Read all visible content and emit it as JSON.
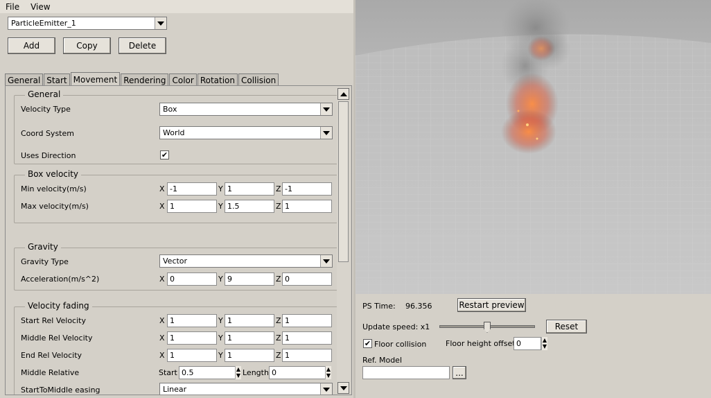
{
  "menu": {
    "file": "File",
    "view": "View"
  },
  "emitter_select": {
    "value": "ParticleEmitter_1"
  },
  "actions": {
    "add": "Add",
    "copy": "Copy",
    "delete": "Delete"
  },
  "tabs": [
    "General",
    "Start",
    "Movement",
    "Rendering",
    "Color",
    "Rotation",
    "Collision"
  ],
  "active_tab": "Movement",
  "general_group": {
    "title": "General",
    "velocity_type_label": "Velocity Type",
    "velocity_type_value": "Box",
    "coord_system_label": "Coord System",
    "coord_system_value": "World",
    "uses_direction_label": "Uses Direction",
    "uses_direction_checked": true
  },
  "box_velocity": {
    "title": "Box velocity",
    "min_label": "Min velocity(m/s)",
    "min": {
      "x": "-1",
      "y": "1",
      "z": "-1"
    },
    "max_label": "Max velocity(m/s)",
    "max": {
      "x": "1",
      "y": "1.5",
      "z": "1"
    }
  },
  "gravity": {
    "title": "Gravity",
    "type_label": "Gravity Type",
    "type_value": "Vector",
    "accel_label": "Acceleration(m/s^2)",
    "accel": {
      "x": "0",
      "y": "9",
      "z": "0"
    }
  },
  "velocity_fading": {
    "title": "Velocity fading",
    "start_label": "Start Rel Velocity",
    "start": {
      "x": "1",
      "y": "1",
      "z": "1"
    },
    "middle_label": "Middle Rel Velocity",
    "middle": {
      "x": "1",
      "y": "1",
      "z": "1"
    },
    "end_label": "End Rel Velocity",
    "end": {
      "x": "1",
      "y": "1",
      "z": "1"
    },
    "middle_relative_label": "Middle Relative",
    "start_word": "Start",
    "start_value": "0.5",
    "length_word": "Length",
    "length_value": "0",
    "easing_label": "StartToMiddle easing",
    "easing_value": "Linear"
  },
  "axes": {
    "x": "X",
    "y": "Y",
    "z": "Z"
  },
  "preview": {
    "ps_time_label": "PS Time:",
    "ps_time_value": "96.356",
    "restart_button": "Restart preview",
    "update_speed_label": "Update speed: x1",
    "update_speed_fraction": 0.5,
    "reset_button": "Reset",
    "floor_collision_label": "Floor collision",
    "floor_collision_checked": true,
    "floor_height_label": "Floor height offset",
    "floor_height_value": "0",
    "ref_model_label": "Ref. Model",
    "ref_model_value": "",
    "browse_button": "..."
  },
  "colors": {
    "panel": "#d4d0c8",
    "viewport_floor": "#c3c3c3",
    "fire": "#ff6a2a",
    "smoke": "#7a7a7a"
  }
}
